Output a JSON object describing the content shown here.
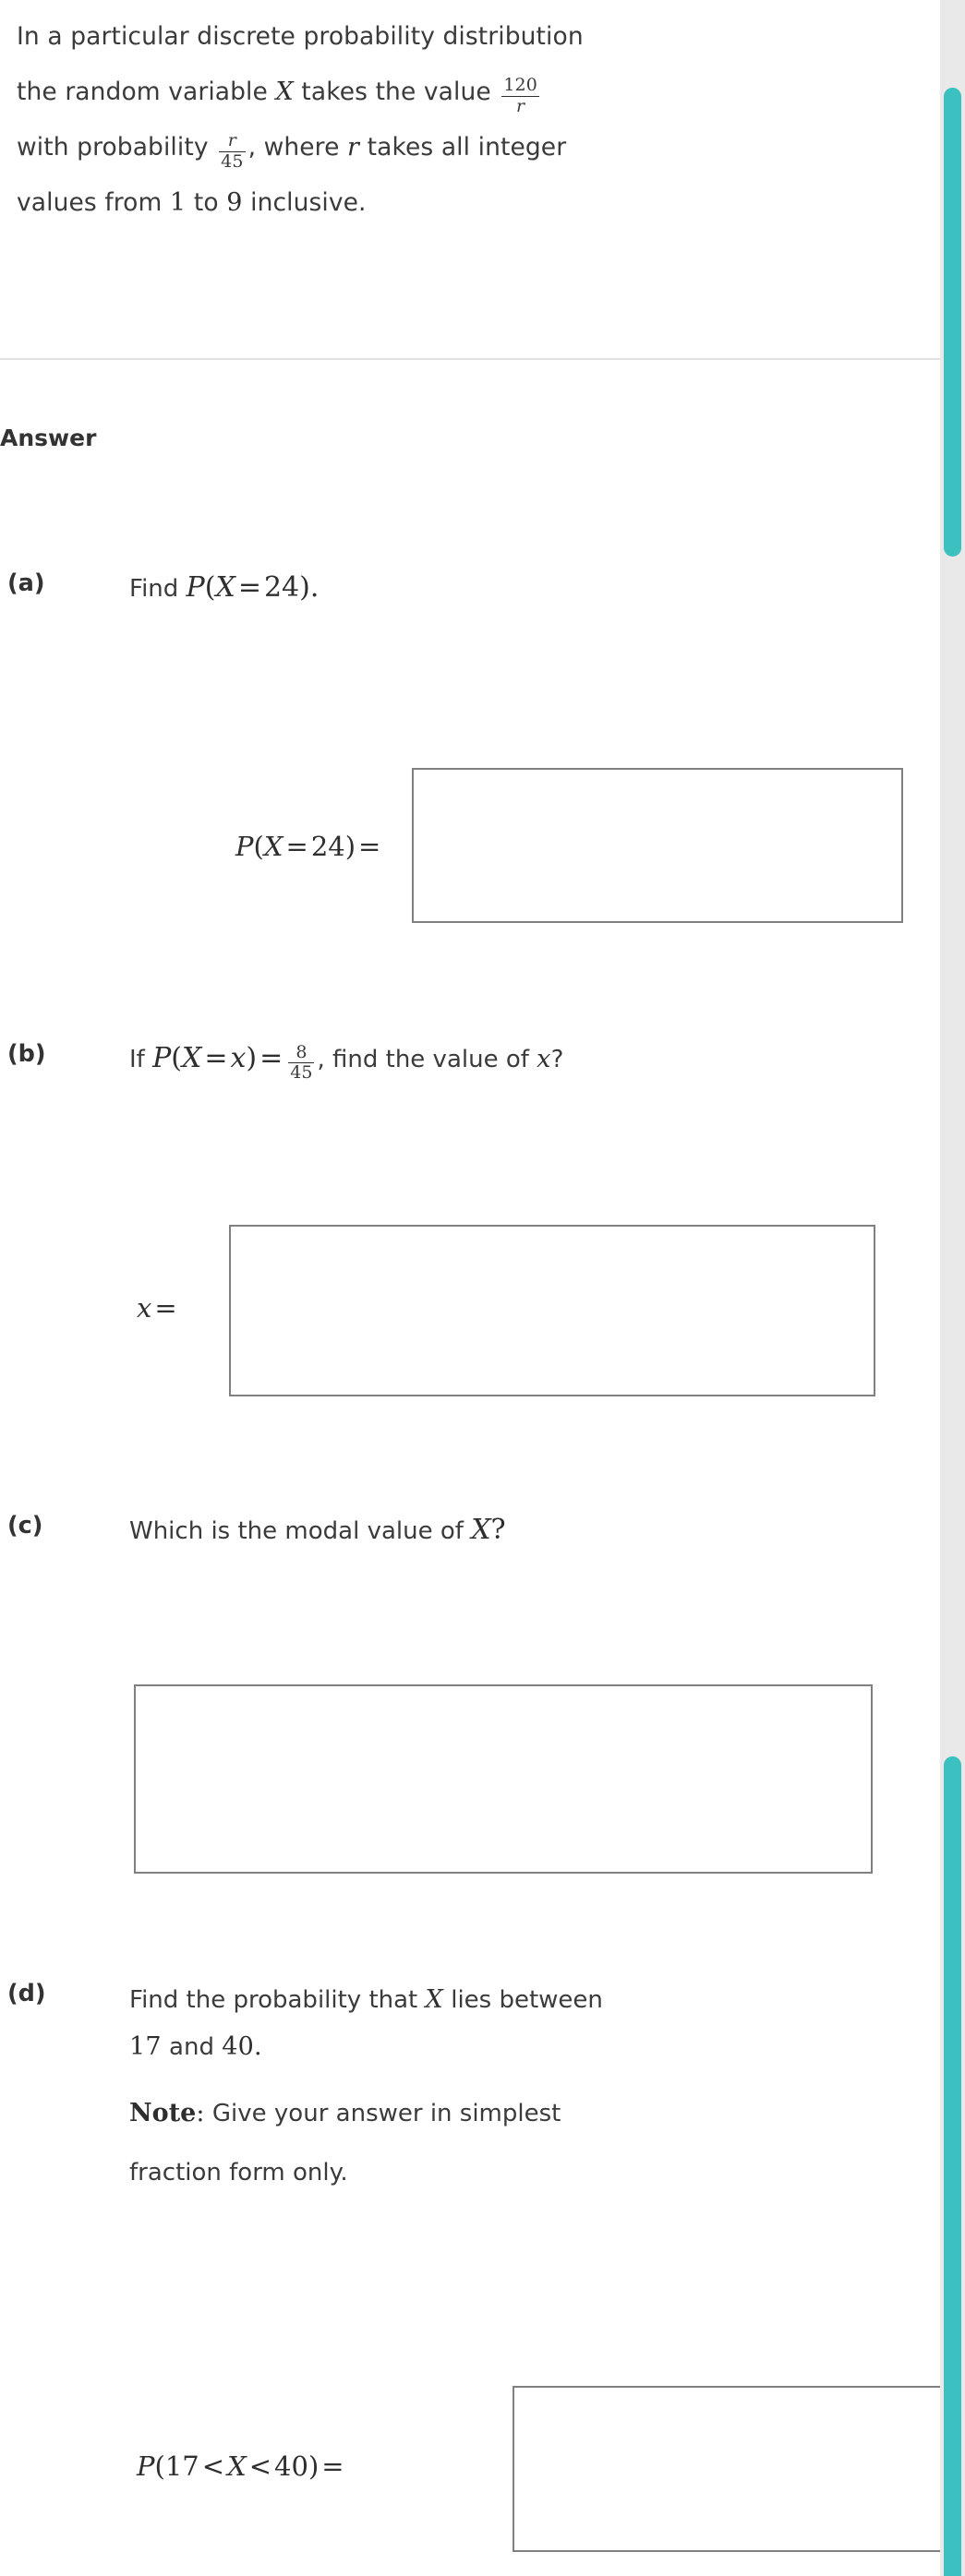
{
  "theme": {
    "accent": "#3cc0c0",
    "scrollbar_track": "#e9e9e9",
    "text": "#3b3b3b",
    "box_border": "#808080",
    "divider": "#e0e0e0"
  },
  "stem": {
    "line1": "In a particular discrete probability distribution",
    "line2_a": "the random variable",
    "line2_var": "X",
    "line2_b": "takes the value",
    "line2_frac_num": "120",
    "line2_frac_den": "r",
    "line3_a": "with probability",
    "line3_frac_num": "r",
    "line3_frac_den": "45",
    "line3_b": ", where",
    "line3_var": "r",
    "line3_c": "takes all integer",
    "line4_a": "values from",
    "line4_from": "1",
    "line4_b": "to",
    "line4_to": "9",
    "line4_c": "inclusive."
  },
  "answer_heading": "Answer",
  "parts": {
    "a": {
      "label": "(a)",
      "text_before": "Find",
      "math": "P(X = 24).",
      "math_P": "P",
      "math_open": "(",
      "math_X": "X",
      "math_eq": "=",
      "math_val": "24",
      "math_close": ")",
      "math_period": ".",
      "answer_label_P": "P",
      "answer_label_open": "(",
      "answer_label_X": "X",
      "answer_label_eq": "=",
      "answer_label_val": "24",
      "answer_label_close": ")",
      "answer_label_equals": "=",
      "answer_value": ""
    },
    "b": {
      "label": "(b)",
      "text_if": "If",
      "math_P": "P",
      "math_open": "(",
      "math_X": "X",
      "math_eq1": "=",
      "math_x": "x",
      "math_close": ")",
      "math_eq2": "=",
      "frac_num": "8",
      "frac_den": "45",
      "text_after": ", find the value of",
      "math_x2": "x",
      "text_q": "?",
      "answer_label_x": "x",
      "answer_label_equals": "=",
      "answer_value": ""
    },
    "c": {
      "label": "(c)",
      "text": "Which is the modal value of",
      "math_X": "X",
      "text_q": "?",
      "answer_value": ""
    },
    "d": {
      "label": "(d)",
      "line1_a": "Find the probability that",
      "line1_X": "X",
      "line1_b": "lies between",
      "line2_from": "17",
      "line2_and": "and",
      "line2_to": "40",
      "line2_period": ".",
      "note_label": "Note",
      "note_colon": ":",
      "note_text": "Give your answer in simplest",
      "note_text2": "fraction form only.",
      "answer_label_P": "P",
      "answer_label_open": "(",
      "answer_label_low": "17",
      "answer_label_lt1": "<",
      "answer_label_X": "X",
      "answer_label_lt2": "<",
      "answer_label_high": "40",
      "answer_label_close": ")",
      "answer_label_equals": "=",
      "answer_value": ""
    }
  },
  "scrollbar": {
    "upper_thumb": "upper-scroll-thumb",
    "lower_thumb": "lower-scroll-thumb"
  }
}
